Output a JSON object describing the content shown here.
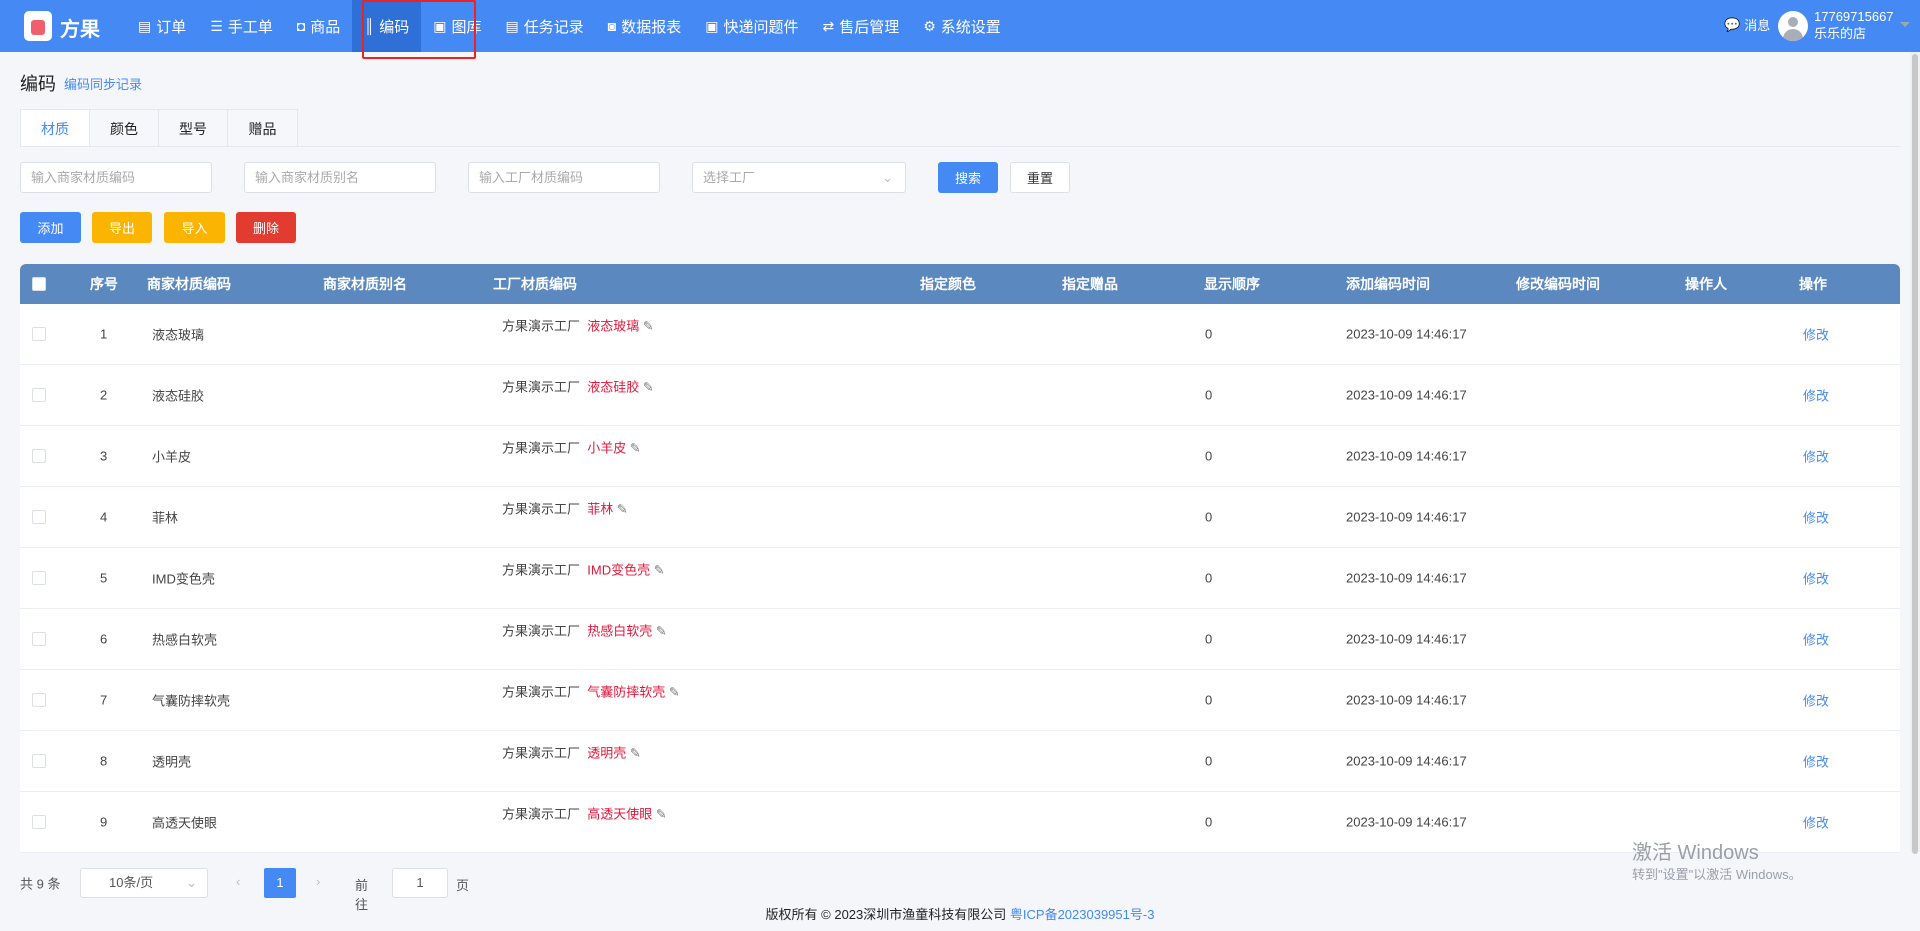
{
  "header": {
    "brand": "方果",
    "nav": [
      {
        "label": "订单",
        "icon": "clipboard-icon",
        "glyph": "▤"
      },
      {
        "label": "手工单",
        "icon": "list-icon",
        "glyph": "☰"
      },
      {
        "label": "商品",
        "icon": "bag-icon",
        "glyph": "◘"
      },
      {
        "label": "编码",
        "icon": "barcode-icon",
        "glyph": "║"
      },
      {
        "label": "图库",
        "icon": "image-icon",
        "glyph": "▣"
      },
      {
        "label": "任务记录",
        "icon": "document-icon",
        "glyph": "▤"
      },
      {
        "label": "数据报表",
        "icon": "chart-icon",
        "glyph": "◙"
      },
      {
        "label": "快递问题件",
        "icon": "package-icon",
        "glyph": "▣"
      },
      {
        "label": "售后管理",
        "icon": "return-icon",
        "glyph": "⇄"
      },
      {
        "label": "系统设置",
        "icon": "gear-icon",
        "glyph": "⚙"
      }
    ],
    "messages": "消息",
    "user_phone": "17769715667",
    "shop": "乐乐的店"
  },
  "page": {
    "title": "编码",
    "sync_link": "编码同步记录",
    "tabs": [
      "材质",
      "颜色",
      "型号",
      "赠品"
    ],
    "filters": {
      "merchant_code": "输入商家材质编码",
      "merchant_alias": "输入商家材质别名",
      "factory_code": "输入工厂材质编码",
      "factory": "选择工厂"
    },
    "search": "搜索",
    "reset": "重置",
    "add": "添加",
    "export": "导出",
    "import": "导入",
    "delete": "删除"
  },
  "colors": {
    "primary": "#4589f5",
    "warning": "#fbb400",
    "danger": "#e23b30"
  },
  "table": {
    "headers": [
      "序号",
      "商家材质编码",
      "商家材质别名",
      "工厂材质编码",
      "指定颜色",
      "指定赠品",
      "显示顺序",
      "添加编码时间",
      "修改编码时间",
      "操作人",
      "操作"
    ],
    "rows": [
      {
        "no": "1",
        "code": "液态玻璃",
        "factory": "方果演示工厂",
        "fcode": "液态玻璃",
        "order": "0",
        "added": "2023-10-09 14:46:17",
        "action": "修改"
      },
      {
        "no": "2",
        "code": "液态硅胶",
        "factory": "方果演示工厂",
        "fcode": "液态硅胶",
        "order": "0",
        "added": "2023-10-09 14:46:17",
        "action": "修改"
      },
      {
        "no": "3",
        "code": "小羊皮",
        "factory": "方果演示工厂",
        "fcode": "小羊皮",
        "order": "0",
        "added": "2023-10-09 14:46:17",
        "action": "修改"
      },
      {
        "no": "4",
        "code": "菲林",
        "factory": "方果演示工厂",
        "fcode": "菲林",
        "order": "0",
        "added": "2023-10-09 14:46:17",
        "action": "修改"
      },
      {
        "no": "5",
        "code": "IMD变色壳",
        "factory": "方果演示工厂",
        "fcode": "IMD变色壳",
        "order": "0",
        "added": "2023-10-09 14:46:17",
        "action": "修改"
      },
      {
        "no": "6",
        "code": "热感白软壳",
        "factory": "方果演示工厂",
        "fcode": "热感白软壳",
        "order": "0",
        "added": "2023-10-09 14:46:17",
        "action": "修改"
      },
      {
        "no": "7",
        "code": "气囊防摔软壳",
        "factory": "方果演示工厂",
        "fcode": "气囊防摔软壳",
        "order": "0",
        "added": "2023-10-09 14:46:17",
        "action": "修改"
      },
      {
        "no": "8",
        "code": "透明壳",
        "factory": "方果演示工厂",
        "fcode": "透明壳",
        "order": "0",
        "added": "2023-10-09 14:46:17",
        "action": "修改"
      },
      {
        "no": "9",
        "code": "高透天使眼",
        "factory": "方果演示工厂",
        "fcode": "高透天使眼",
        "order": "0",
        "added": "2023-10-09 14:46:17",
        "action": "修改"
      }
    ]
  },
  "pagination": {
    "total": "共 9 条",
    "page_size": "10条/页",
    "current": "1",
    "goto": "前往",
    "goto_value": "1",
    "page_unit": "页"
  },
  "footer": {
    "copyright": "版权所有 © 2023深圳市渔童科技有限公司",
    "icp": "粤ICP备2023039951号-3"
  },
  "watermark": {
    "line1": "激活 Windows",
    "line2": "转到\"设置\"以激活 Windows。"
  }
}
